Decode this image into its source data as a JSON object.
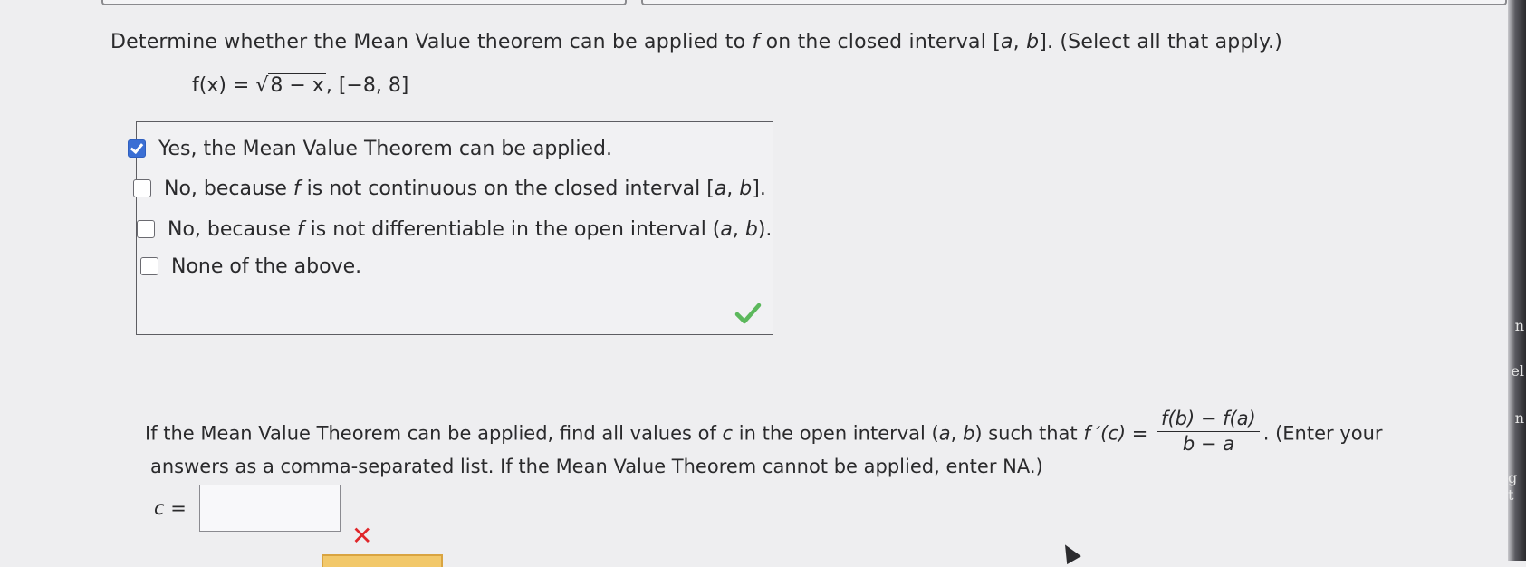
{
  "question": {
    "text_pre": "Determine whether the Mean Value theorem can be applied to ",
    "text_f": "f",
    "text_mid": " on the closed interval [",
    "text_a": "a",
    "text_comma": ", ",
    "text_b": "b",
    "text_post": "]. (Select all that apply.)"
  },
  "function": {
    "lhs": "f(x) = ",
    "radicand": "8 − x",
    "interval": ",    [−8, 8]"
  },
  "options": [
    {
      "checked": true,
      "label": "Yes, the Mean Value Theorem can be applied."
    },
    {
      "checked": false,
      "label_pre": "No, because ",
      "label_f": "f",
      "label_mid": " is not continuous on the closed interval [",
      "label_a": "a",
      "label_comma": ", ",
      "label_b": "b",
      "label_post": "]."
    },
    {
      "checked": false,
      "label_pre": "No, because ",
      "label_f": "f",
      "label_mid": " is not differentiable in the open interval (",
      "label_a": "a",
      "label_comma": ", ",
      "label_b": "b",
      "label_post": ")."
    },
    {
      "checked": false,
      "label": "None of the above."
    }
  ],
  "part2": {
    "line1_pre": "If the Mean Value Theorem can be applied, find all values of ",
    "line1_c": "c",
    "line1_mid": " in the open interval (",
    "line1_a": "a",
    "line1_comma": ", ",
    "line1_b": "b",
    "line1_such": ") such that ",
    "line1_fpc": "f ′(c)",
    "line1_eq": " = ",
    "frac_num": "f(b) − f(a)",
    "frac_den": "b − a",
    "line1_post": ". (Enter your",
    "line2": "answers as a comma-separated list. If the Mean Value Theorem cannot be applied, enter NA.)",
    "answer_label": "c =",
    "answer_value": ""
  },
  "feedback": {
    "options_correct_color": "#5cb85c",
    "answer_incorrect_symbol": "✕",
    "answer_incorrect_color": "#e0262a"
  },
  "bezel_text": [
    "n",
    "el",
    "n",
    "g t"
  ]
}
